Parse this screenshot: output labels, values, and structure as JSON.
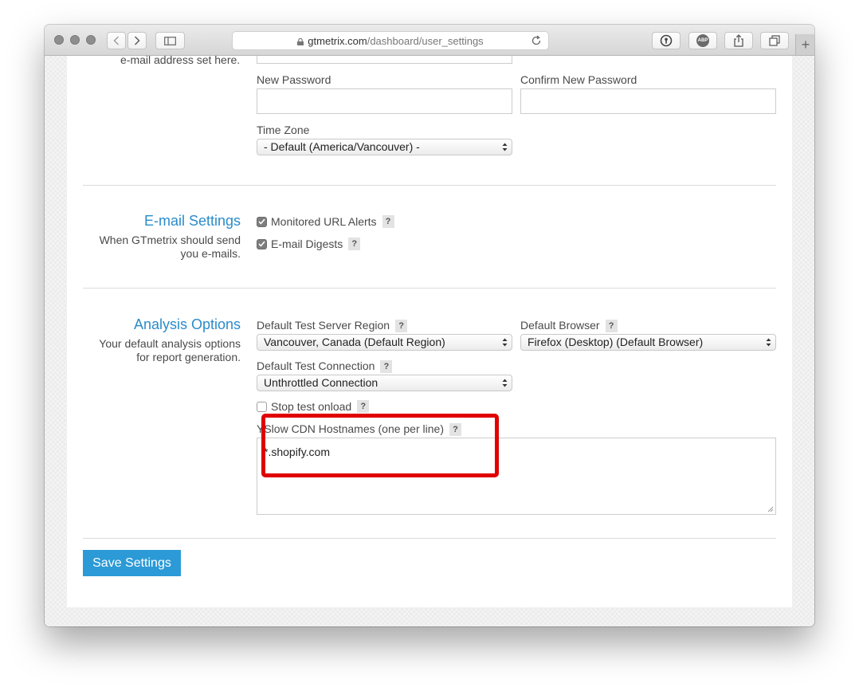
{
  "browser": {
    "url_domain": "gtmetrix.com",
    "url_path": "/dashboard/user_settings",
    "new_tab_label": "+",
    "abp_label": "ABP"
  },
  "account": {
    "email_note": "e-mail address set here.",
    "new_password_label": "New Password",
    "confirm_password_label": "Confirm New Password",
    "time_zone_label": "Time Zone",
    "time_zone_value": "- Default (America/Vancouver) -"
  },
  "email_settings": {
    "title": "E-mail Settings",
    "desc_line1": "When GTmetrix should send",
    "desc_line2": "you e-mails.",
    "monitored_label": "Monitored URL Alerts",
    "monitored_checked": true,
    "digests_label": "E-mail Digests",
    "digests_checked": true
  },
  "analysis": {
    "title": "Analysis Options",
    "desc_line1": "Your default analysis options",
    "desc_line2": "for report generation.",
    "region_label": "Default Test Server Region",
    "region_value": "Vancouver, Canada (Default Region)",
    "browser_label": "Default Browser",
    "browser_value": "Firefox (Desktop) (Default Browser)",
    "connection_label": "Default Test Connection",
    "connection_value": "Unthrottled Connection",
    "stop_onload_label": "Stop test onload",
    "stop_onload_checked": false,
    "cdn_label": "YSlow CDN Hostnames (one per line)",
    "cdn_value": "*.shopify.com"
  },
  "help_glyph": "?",
  "save_label": "Save Settings",
  "colors": {
    "accent": "#2a8cc9",
    "button": "#2b9ad6",
    "highlight": "#e00000"
  }
}
